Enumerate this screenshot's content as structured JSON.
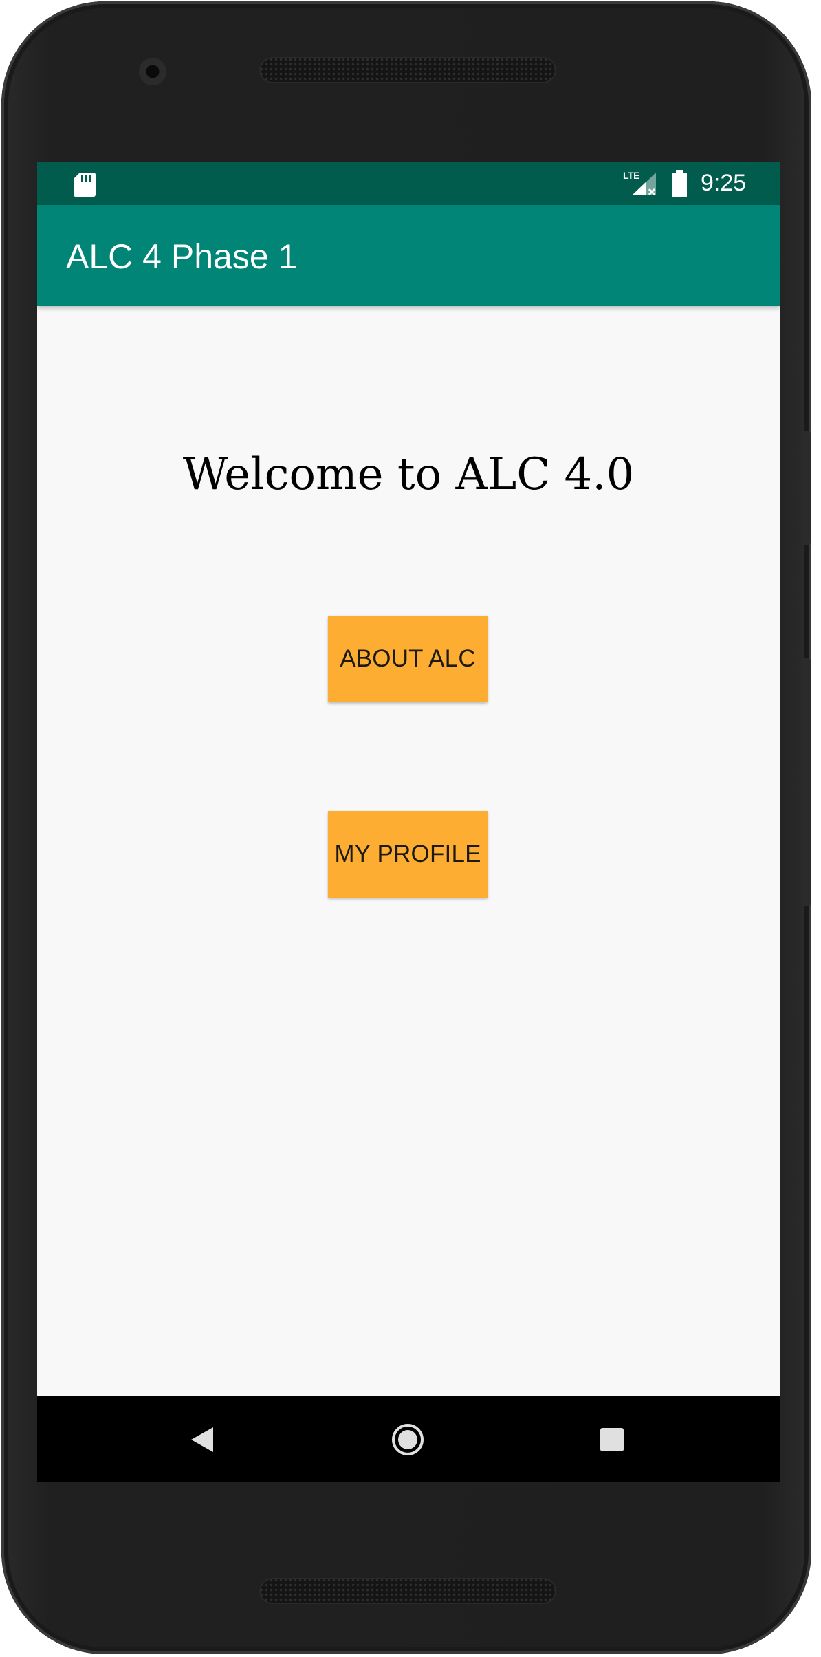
{
  "status_bar": {
    "network_label": "LTE",
    "time": "9:25",
    "icons": [
      "sd-card-icon",
      "signal-icon",
      "battery-icon"
    ]
  },
  "app_bar": {
    "title": "ALC 4 Phase 1"
  },
  "main": {
    "welcome_text": "Welcome to ALC 4.0",
    "buttons": [
      {
        "label": "ABOUT ALC"
      },
      {
        "label": "MY PROFILE"
      }
    ]
  },
  "nav_bar": {
    "icons": [
      "back-icon",
      "home-icon",
      "recents-icon"
    ]
  },
  "colors": {
    "status_bar": "#015c4e",
    "app_bar": "#018577",
    "button": "#fdad31",
    "screen_background": "#f8f8f8",
    "nav_bar": "#000000"
  }
}
